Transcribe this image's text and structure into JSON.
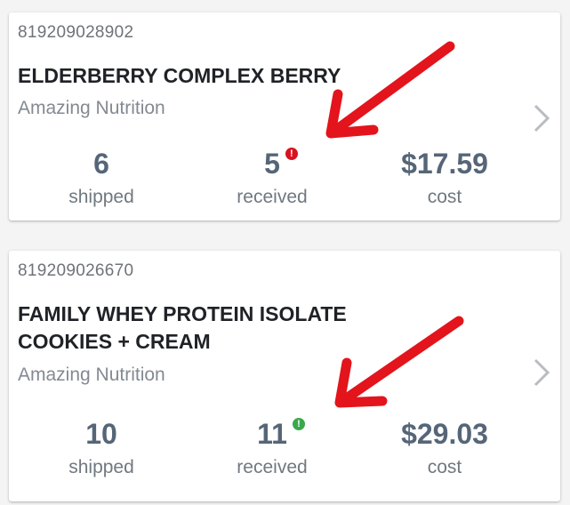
{
  "products": [
    {
      "sku": "819209028902",
      "name": "ELDERBERRY COMPLEX BERRY",
      "brand": "Amazing Nutrition",
      "shipped": "6",
      "shipped_label": "shipped",
      "received": "5",
      "received_label": "received",
      "received_badge": "!",
      "cost": "$17.59",
      "cost_label": "cost",
      "badge_color": "#d9121f"
    },
    {
      "sku": "819209026670",
      "name_line1": "FAMILY WHEY PROTEIN ISOLATE",
      "name_line2": "COOKIES + CREAM",
      "brand": "Amazing Nutrition",
      "shipped": "10",
      "shipped_label": "shipped",
      "received": "11",
      "received_label": "received",
      "received_badge": "!",
      "cost": "$29.03",
      "cost_label": "cost",
      "badge_color": "#3aa84b"
    }
  ],
  "icons": {
    "chevron": "chevron-right-icon",
    "annotation": "red-arrow-annotation"
  },
  "colors": {
    "arrow": "#e3141c",
    "value_text": "#566678"
  }
}
